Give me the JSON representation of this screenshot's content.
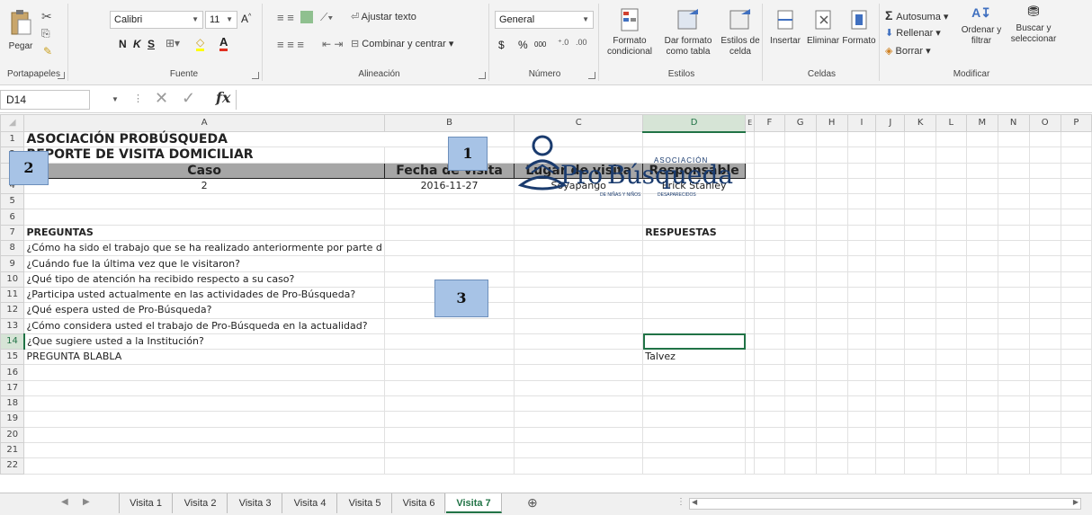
{
  "ribbon": {
    "clipboard": {
      "label": "Portapapeles",
      "paste": "Pegar"
    },
    "font": {
      "label": "Fuente",
      "name": "Calibri",
      "size": "11",
      "bold": "N",
      "italic": "K",
      "underline": "S"
    },
    "alignment": {
      "label": "Alineación",
      "wrap": "Ajustar texto",
      "merge": "Combinar y centrar"
    },
    "number": {
      "label": "Número",
      "format": "General",
      "currency": "$",
      "percent": "%",
      "thousands": "000"
    },
    "styles": {
      "label": "Estilos",
      "conditional": "Formato condicional",
      "table": "Dar formato como tabla",
      "cell": "Estilos de celda"
    },
    "cells": {
      "label": "Celdas",
      "insert": "Insertar",
      "delete": "Eliminar",
      "format": "Formato"
    },
    "editing": {
      "label": "Modificar",
      "autosum": "Autosuma",
      "fill": "Rellenar",
      "clear": "Borrar",
      "sort": "Ordenar y filtrar",
      "find": "Buscar y seleccionar"
    }
  },
  "formula_bar": {
    "name_box": "D14",
    "fx": "fx",
    "value": ""
  },
  "columns": [
    "A",
    "B",
    "C",
    "D",
    "E",
    "F",
    "G",
    "H",
    "I",
    "J",
    "K",
    "L",
    "M",
    "N",
    "O",
    "P"
  ],
  "rows": {
    "r1": {
      "num": "1",
      "A": "ASOCIACIÓN PROBÚSQUEDA"
    },
    "r2": {
      "num": "2",
      "A": "REPORTE DE VISITA DOMICILIAR"
    },
    "r3": {
      "num": "3",
      "A": "Caso",
      "B": "Fecha de visita",
      "C": "Lugar de visita",
      "D": "Responsable"
    },
    "r4": {
      "num": "4",
      "A": "2",
      "B": "2016-11-27",
      "C": "Soyapango",
      "D": "Erick Stanley"
    },
    "r5": {
      "num": "5"
    },
    "r6": {
      "num": "6"
    },
    "r7": {
      "num": "7",
      "A": "PREGUNTAS",
      "D": "RESPUESTAS"
    },
    "r8": {
      "num": "8",
      "A": "¿Cómo ha sido el trabajo que se ha realizado anteriormente por parte d"
    },
    "r9": {
      "num": "9",
      "A": "¿Cuándo fue la última vez que le visitaron?"
    },
    "r10": {
      "num": "10",
      "A": "¿Qué tipo de atención ha recibido respecto a su caso?"
    },
    "r11": {
      "num": "11",
      "A": "¿Participa usted actualmente en las actividades de Pro-Búsqueda?"
    },
    "r12": {
      "num": "12",
      "A": "¿Qué espera usted de Pro-Búsqueda?"
    },
    "r13": {
      "num": "13",
      "A": "¿Cómo considera usted el trabajo de Pro-Búsqueda en la actualidad?"
    },
    "r14": {
      "num": "14",
      "A": "¿Que sugiere usted a la Institución?"
    },
    "r15": {
      "num": "15",
      "A": "PREGUNTA BLABLA",
      "D": "Talvez"
    },
    "r16": {
      "num": "16"
    },
    "r17": {
      "num": "17"
    },
    "r18": {
      "num": "18"
    },
    "r19": {
      "num": "19"
    },
    "r20": {
      "num": "20"
    },
    "r21": {
      "num": "21"
    },
    "r22": {
      "num": "22"
    }
  },
  "logo": {
    "pro": "Pro",
    "busqueda": "Búsqueda",
    "asociacion": "ASOCIACIÓN",
    "sub1": "DE NIÑAS Y NIÑOS",
    "sub2": "DESAPARECIDOS"
  },
  "markers": {
    "m1": "1",
    "m2": "2",
    "m3": "3"
  },
  "tabs": [
    "Visita 1",
    "Visita 2",
    "Visita 3",
    "Visita 4",
    "Visita 5",
    "Visita 6",
    "Visita 7"
  ],
  "active_tab": "Visita 7",
  "colors": {
    "accent": "#217346",
    "header_fill": "#a6a6a6",
    "marker": "#a7c3e6"
  }
}
